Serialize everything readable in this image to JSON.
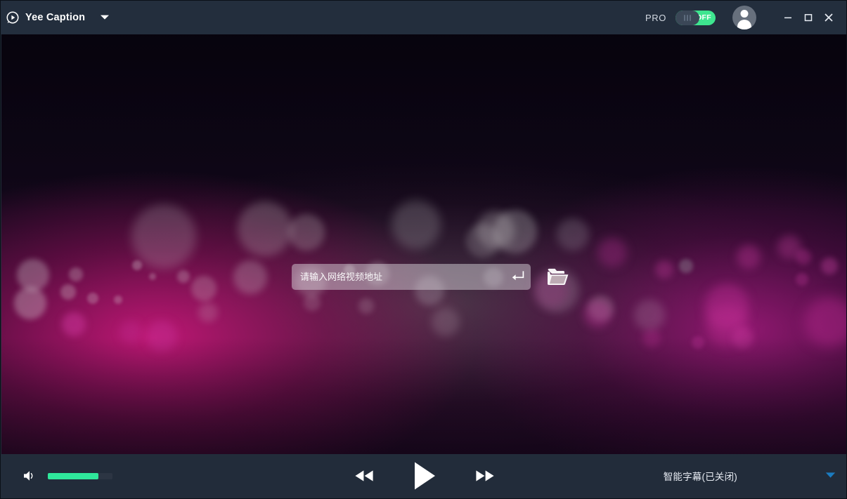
{
  "window": {
    "app_title": "Yee Caption",
    "logo_icon": "play-circle-icon",
    "title_dropdown_icon": "chevron-down-icon",
    "pro_label": "PRO",
    "pro_toggle_state": "OFF",
    "avatar_icon": "user-avatar-icon",
    "minimize_icon": "minimize-icon",
    "maximize_icon": "maximize-icon",
    "close_icon": "close-icon"
  },
  "stage": {
    "url_input": {
      "placeholder": "请输入网络视频地址",
      "value": "",
      "submit_icon": "enter-return-icon"
    },
    "open_file_icon": "open-folder-icon"
  },
  "controls": {
    "volume_icon": "speaker-volume-icon",
    "volume_percent": 78,
    "rewind_icon": "rewind-icon",
    "play_icon": "play-icon",
    "forward_icon": "fast-forward-icon",
    "subtitle_label": "智能字幕(已关闭)",
    "subtitle_caret_icon": "caret-down-icon"
  },
  "colors": {
    "titlebar_bg": "#232e3d",
    "controlbar_bg": "#222c3a",
    "accent_green": "#2fe79b",
    "toggle_green": "#3ee58f",
    "caret_blue": "#1b7cc0",
    "text_primary": "#ffffff"
  }
}
